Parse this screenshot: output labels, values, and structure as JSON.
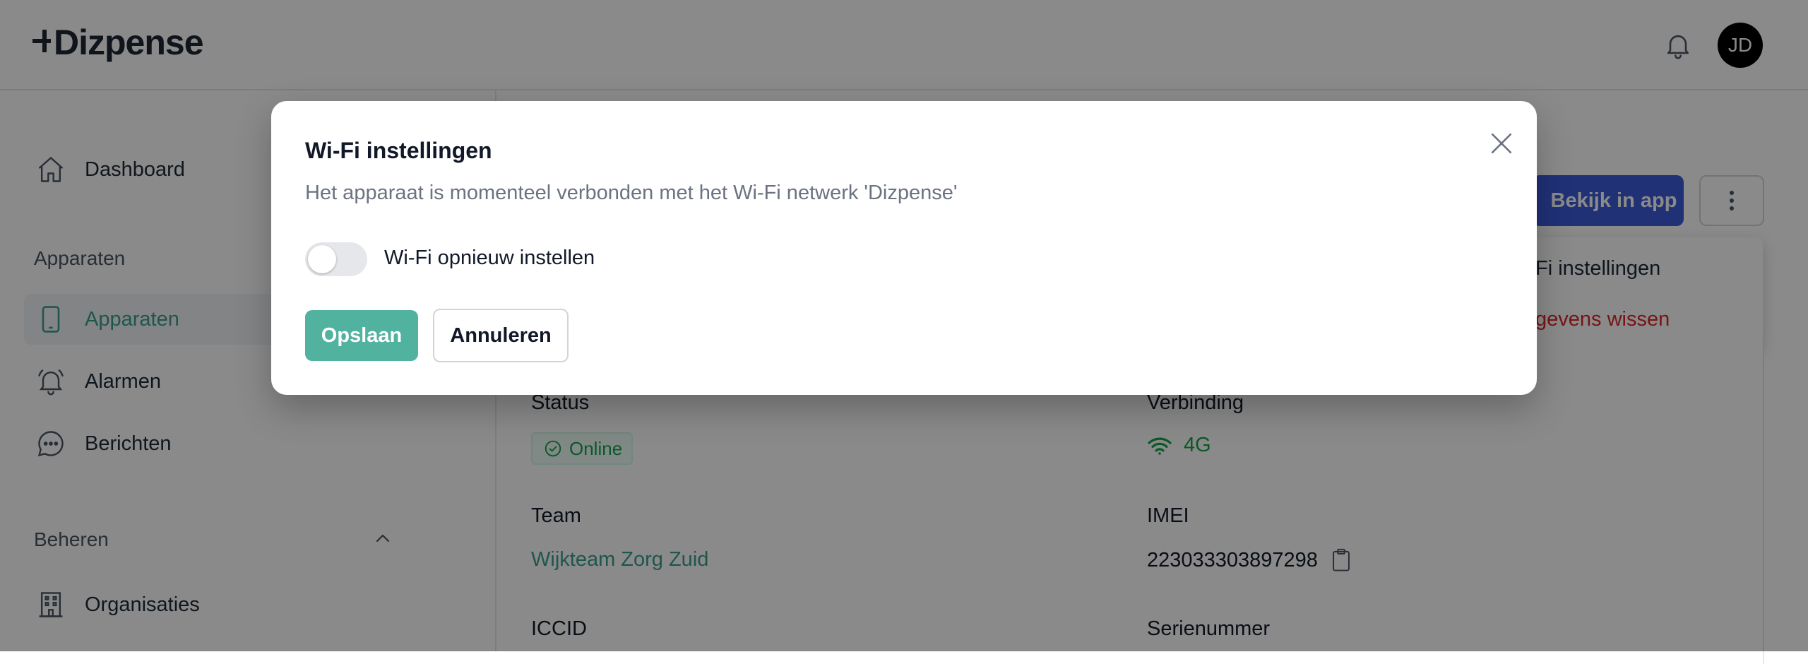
{
  "header": {
    "logo_text": "Dizpense",
    "avatar_initials": "JD"
  },
  "sidebar": {
    "dashboard": "Dashboard",
    "section_devices": "Apparaten",
    "items": [
      {
        "label": "Apparaten",
        "icon": "tablet-icon"
      },
      {
        "label": "Alarmen",
        "icon": "alarm-bell-icon"
      },
      {
        "label": "Berichten",
        "icon": "chat-bubble-icon"
      }
    ],
    "section_manage": "Beheren",
    "organisations": "Organisaties"
  },
  "actions": {
    "view_in_app": "Bekijk in app"
  },
  "dropdown": {
    "wifi_settings": "Fi instellingen",
    "wipe_data": "gevens wissen"
  },
  "details": {
    "status_label": "Status",
    "status_value": "Online",
    "connection_label": "Verbinding",
    "connection_value": "4G",
    "team_label": "Team",
    "team_value": "Wijkteam Zorg Zuid",
    "imei_label": "IMEI",
    "imei_value": "223033303897298",
    "iccid_label": "ICCID",
    "serial_label": "Serienummer"
  },
  "modal": {
    "title": "Wi-Fi instellingen",
    "description": "Het apparaat is momenteel verbonden met het Wi-Fi netwerk 'Dizpense'",
    "toggle_label": "Wi-Fi opnieuw instellen",
    "toggle_on": false,
    "save": "Opslaan",
    "cancel": "Annuleren"
  },
  "colors": {
    "accent_teal": "#52b2a0",
    "primary_blue": "#3b5bdb",
    "success_green": "#16a34a",
    "danger_red": "#dc2626"
  }
}
